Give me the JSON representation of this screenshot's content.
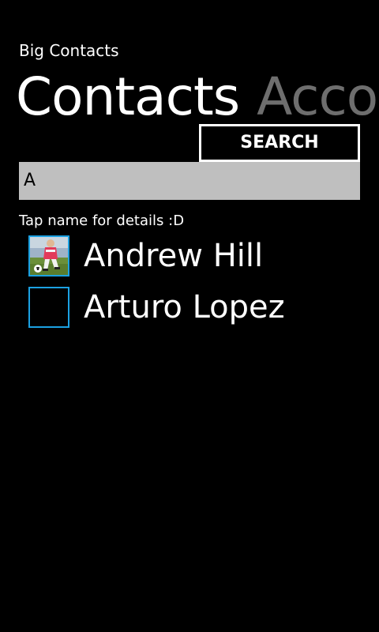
{
  "app": {
    "title": "Big Contacts"
  },
  "pivot": {
    "headers": [
      {
        "label": "Contacts",
        "active": true
      },
      {
        "label": "Accou",
        "active": false
      }
    ]
  },
  "search": {
    "button_label": "SEARCH",
    "input_value": "A"
  },
  "hint": "Tap name for details :D",
  "contacts": [
    {
      "name": "Andrew Hill",
      "avatar": "soccer-player-photo"
    },
    {
      "name": "Arturo Lopez",
      "avatar": "empty-avatar-placeholder"
    }
  ],
  "colors": {
    "background": "#000000",
    "foreground": "#ffffff",
    "inactive_header": "#6e6e6e",
    "input_background": "#bfbfbf",
    "accent": "#1ba1e2"
  }
}
